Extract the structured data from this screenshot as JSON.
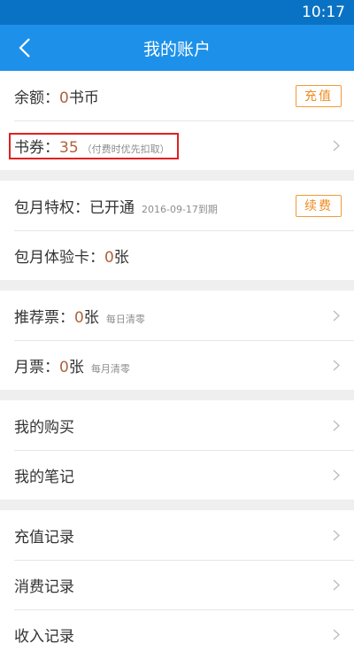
{
  "status_bar": {
    "time": "10:17"
  },
  "header": {
    "title": "我的账户",
    "back_icon": "back-arrow-icon"
  },
  "balance": {
    "label": "余额：",
    "value": "0",
    "unit": "书币",
    "button": "充值"
  },
  "voucher": {
    "label": "书券：",
    "value": "35",
    "note": "（付费时优先扣取）"
  },
  "monthly": {
    "label": "包月特权：已开通",
    "expiry": "2016-09-17到期",
    "button": "续费"
  },
  "trial_card": {
    "label": "包月体验卡：",
    "value": "0",
    "unit": "张"
  },
  "recommend_ticket": {
    "label": "推荐票：",
    "value": "0",
    "unit": "张",
    "note": "每日清零"
  },
  "monthly_ticket": {
    "label": "月票：",
    "value": "0",
    "unit": "张",
    "note": "每月清零"
  },
  "links": {
    "purchases": "我的购买",
    "notes": "我的笔记",
    "recharge_records": "充值记录",
    "consumption_records": "消费记录",
    "income_records": "收入记录"
  },
  "colors": {
    "primary": "#1d91ea",
    "status_bar": "#0a72c4",
    "accent": "#f08a1e",
    "value": "#b0623a",
    "highlight": "#e02020"
  }
}
